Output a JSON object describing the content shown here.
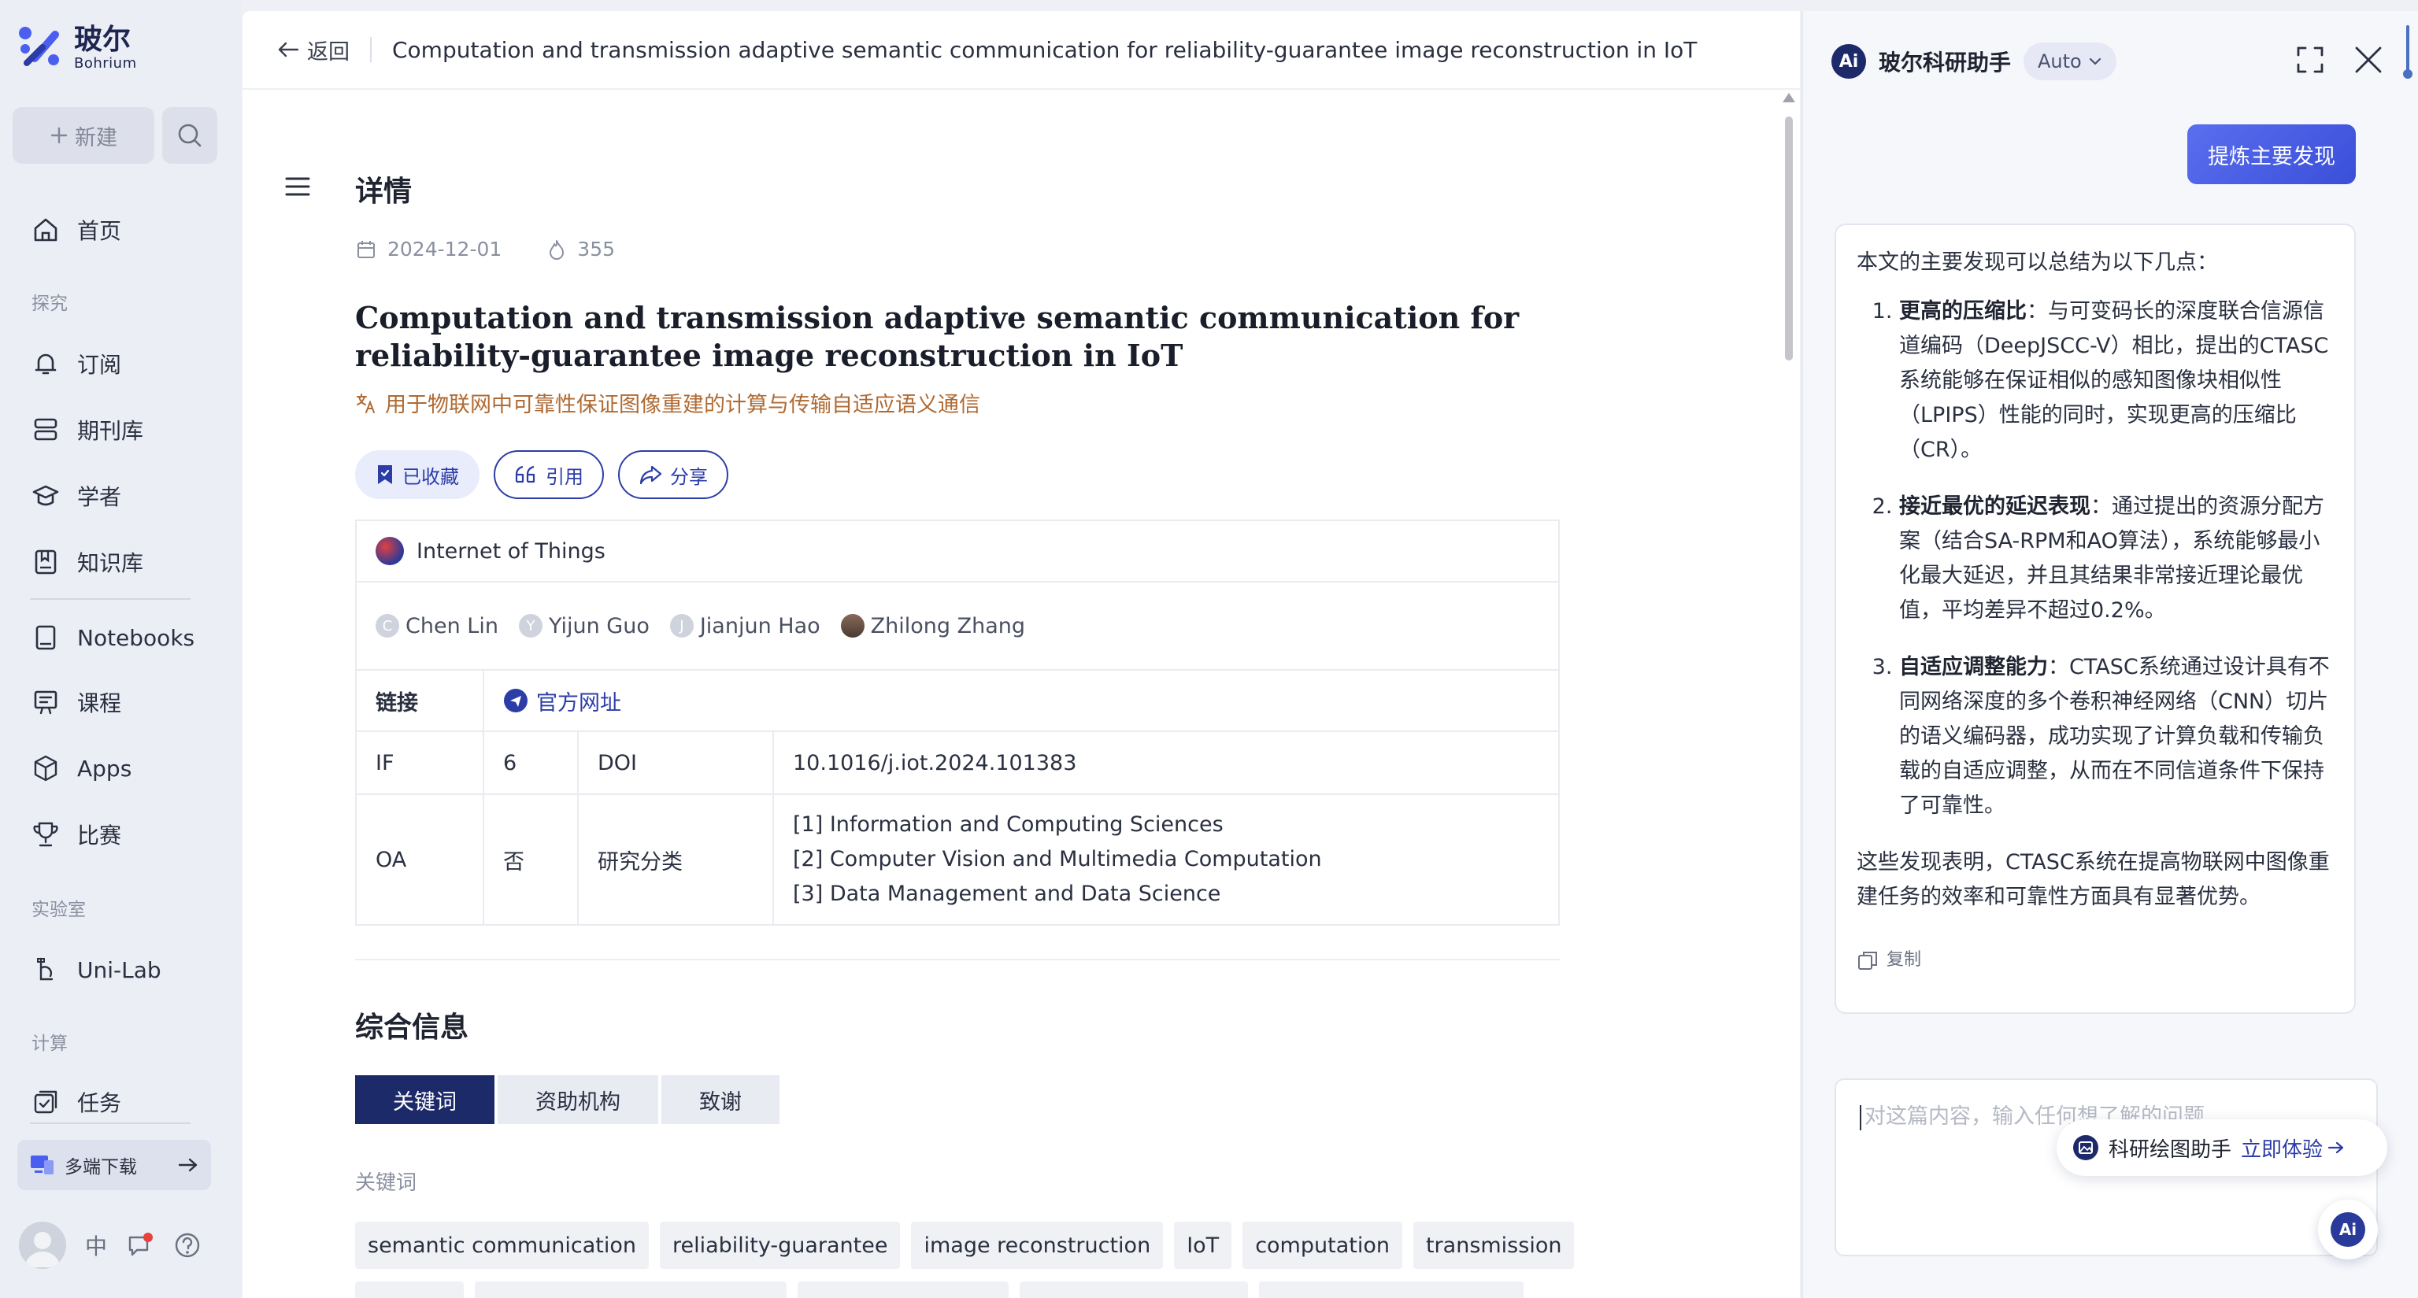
{
  "brand": {
    "name_cn": "玻尔",
    "name_en": "Bohrium"
  },
  "sidebar": {
    "new_label": "新建",
    "home": "首页",
    "section_explore": "探究",
    "subscribe": "订阅",
    "journals": "期刊库",
    "scholars": "学者",
    "knowledge": "知识库",
    "notebooks": "Notebooks",
    "courses": "课程",
    "apps": "Apps",
    "contests": "比赛",
    "section_lab": "实验室",
    "unilab": "Uni-Lab",
    "section_compute": "计算",
    "tasks": "任务",
    "download": "多端下载",
    "lang": "中"
  },
  "topbar": {
    "back": "返回",
    "title": "Computation and transmission adaptive semantic communication for reliability-guarantee image reconstruction in IoT"
  },
  "detail": {
    "heading": "详情",
    "date": "2024-12-01",
    "heat": "355",
    "title": "Computation and transmission adaptive semantic communication for reliability-guarantee image reconstruction in IoT",
    "title_cn": "用于物联网中可靠性保证图像重建的计算与传输自适应语义通信",
    "actions": {
      "saved": "已收藏",
      "cite": "引用",
      "share": "分享"
    },
    "journal": "Internet of Things",
    "authors": [
      {
        "initial": "C",
        "name": "Chen Lin"
      },
      {
        "initial": "Y",
        "name": "Yijun Guo"
      },
      {
        "initial": "J",
        "name": "Jianjun Hao"
      },
      {
        "initial": "",
        "name": "Zhilong Zhang"
      }
    ],
    "link_label": "链接",
    "link_text": "官方网址",
    "if_label": "IF",
    "if_value": "6",
    "doi_label": "DOI",
    "doi_value": "10.1016/j.iot.2024.101383",
    "oa_label": "OA",
    "oa_value": "否",
    "category_label": "研究分类",
    "categories": [
      "[1] Information and Computing Sciences",
      "[2] Computer Vision and Multimedia Computation",
      "[3] Data Management and Data Science"
    ]
  },
  "overview": {
    "heading": "综合信息",
    "tabs": [
      "关键词",
      "资助机构",
      "致谢"
    ],
    "keywords_label": "关键词",
    "keywords": [
      "semantic communication",
      "reliability-guarantee",
      "image reconstruction",
      "IoT",
      "computation",
      "transmission"
    ]
  },
  "assistant": {
    "logo": "Ai",
    "title": "玻尔科研助手",
    "mode": "Auto",
    "user_message": "提炼主要发现",
    "intro": "本文的主要发现可以总结为以下几点：",
    "points": [
      {
        "bold": "更高的压缩比",
        "text": "：与可变码长的深度联合信源信道编码（DeepJSCC-V）相比，提出的CTASC系统能够在保证相似的感知图像块相似性（LPIPS）性能的同时，实现更高的压缩比（CR）。"
      },
      {
        "bold": "接近最优的延迟表现",
        "text": "：通过提出的资源分配方案（结合SA-RPM和AO算法），系统能够最小化最大延迟，并且其结果非常接近理论最优值，平均差异不超过0.2%。"
      },
      {
        "bold": "自适应调整能力",
        "text": "：CTASC系统通过设计具有不同网络深度的多个卷积神经网络（CNN）切片的语义编码器，成功实现了计算负载和传输负载的自适应调整，从而在不同信道条件下保持了可靠性。"
      }
    ],
    "conclusion": "这些发现表明，CTASC系统在提高物联网中图像重建任务的效率和可靠性方面具有显著优势。",
    "copy": "复制",
    "input_placeholder": "对这篇内容，输入任何想了解的问题",
    "promo_text": "科研绘图助手",
    "promo_try": "立即体验"
  },
  "colors": {
    "accent": "#2c3da8",
    "brand_dark": "#1d2a6a",
    "cn_subtitle": "#b06a32"
  }
}
